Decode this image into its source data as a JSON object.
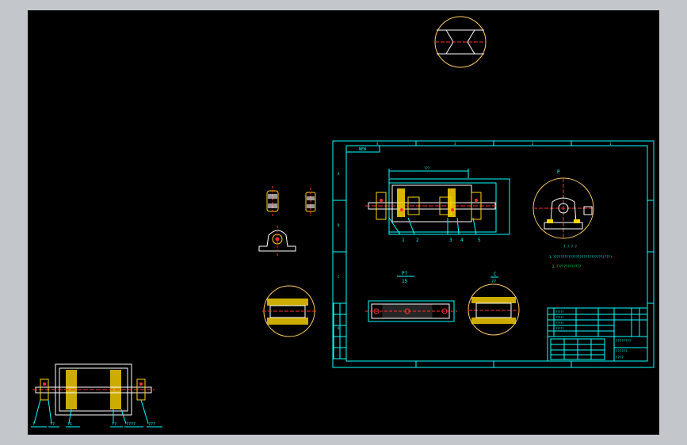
{
  "sheet": {
    "corner_label": "NEW",
    "zones_top": [
      "4",
      "3",
      "2",
      "1"
    ],
    "zones_left": [
      "A",
      "B",
      "C",
      "D"
    ],
    "section_p": "P",
    "view_c_label": "C",
    "view_c_sub": "??",
    "view_p_label": "P?",
    "view_p_sub": "15",
    "dim_width": "???",
    "dim_small": "??",
    "note_title": "? ? ? ?",
    "note_line1": "1.??????????????????????????(???)",
    "note_line2": "2.?????????????",
    "balloons": [
      "1",
      "2",
      "3",
      "4",
      "5"
    ],
    "title_block": {
      "name": "????????",
      "drawing_no": "??????",
      "sub_title": "????",
      "rows": [
        "?????",
        "?????",
        "?????",
        "?????"
      ]
    }
  },
  "left_labels": [
    "?",
    "??",
    "?1",
    "??",
    "????",
    "???"
  ],
  "colors": {
    "background": "#000000",
    "frame": "#00ffff",
    "cyan": "#00ffff",
    "part_white": "#ffffff",
    "hatch_yellow": "#ffd700",
    "circle": "#ffcc66",
    "center_red": "#ff3030",
    "green_text": "#00ff66"
  }
}
